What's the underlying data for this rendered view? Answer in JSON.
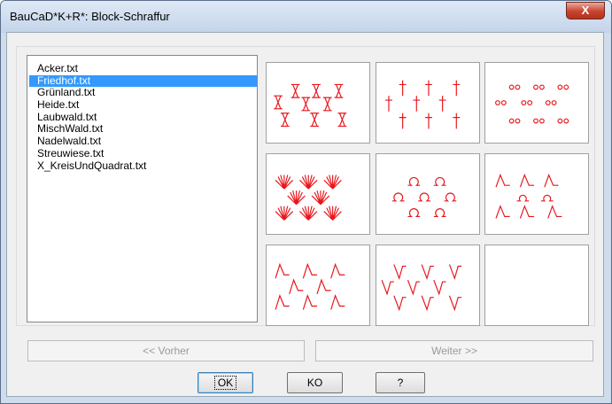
{
  "window": {
    "title": "BauCaD*K+R*: Block-Schraffur",
    "close_label": "X"
  },
  "list": {
    "items": [
      "Acker.txt",
      "Friedhof.txt",
      "Grünland.txt",
      "Heide.txt",
      "Laubwald.txt",
      "MischWald.txt",
      "Nadelwald.txt",
      "Streuwiese.txt",
      "X_KreisUndQuadrat.txt"
    ],
    "selected_index": 1
  },
  "tiles": [
    {
      "pattern": "x-marks-icon"
    },
    {
      "pattern": "crosses-icon"
    },
    {
      "pattern": "double-circles-icon"
    },
    {
      "pattern": "fan-marks-icon"
    },
    {
      "pattern": "omega-icon"
    },
    {
      "pattern": "peak-marks-icon"
    },
    {
      "pattern": "peak-marks-icon"
    },
    {
      "pattern": "valley-marks-icon"
    },
    {
      "pattern": "empty"
    }
  ],
  "buttons": {
    "prev_label": "<< Vorher",
    "next_label": "Weiter >>",
    "ok_label": "OK",
    "ko_label": "KO",
    "help_label": "?"
  },
  "colors": {
    "pattern": "#e8161b",
    "selection": "#3399ff"
  }
}
